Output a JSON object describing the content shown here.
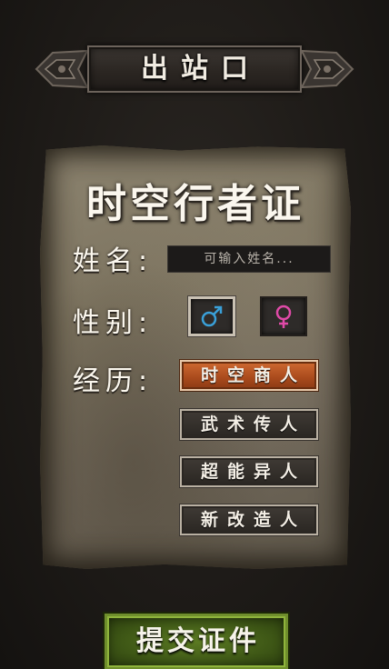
{
  "header": {
    "title": "出站口"
  },
  "card": {
    "title": "时空行者证",
    "name": {
      "label": "姓名:",
      "placeholder": "可输入姓名...",
      "value": ""
    },
    "gender": {
      "label": "性别:",
      "options": [
        {
          "symbol": "♂",
          "name": "male-icon",
          "color": "#3aa0d8",
          "selected": true
        },
        {
          "symbol": "♀",
          "name": "female-icon",
          "color": "#e04aa8",
          "selected": false
        }
      ]
    },
    "career": {
      "label": "经历:",
      "options": [
        {
          "label": "时空商人",
          "selected": true
        },
        {
          "label": "武术传人",
          "selected": false
        },
        {
          "label": "超能异人",
          "selected": false
        },
        {
          "label": "新改造人",
          "selected": false
        }
      ]
    }
  },
  "footer": {
    "submit_label": "提交证件"
  },
  "colors": {
    "selected_career": "#b04f20",
    "submit_green": "#4a6a1a",
    "parchment": "#7e7562"
  }
}
